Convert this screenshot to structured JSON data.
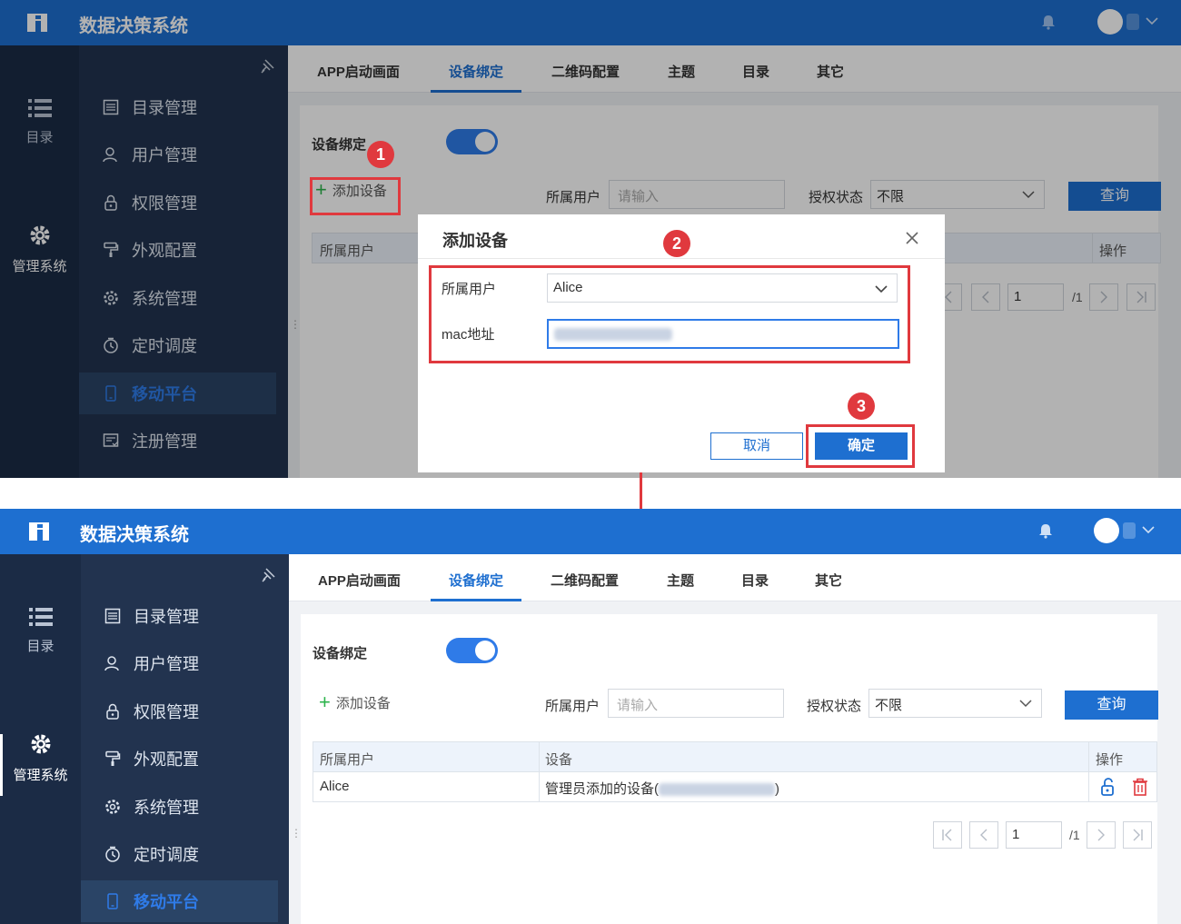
{
  "app": {
    "title": "数据决策系统"
  },
  "rail": {
    "catalog_label": "目录",
    "manage_label": "管理系统"
  },
  "menu": {
    "items": [
      {
        "label": "目录管理"
      },
      {
        "label": "用户管理"
      },
      {
        "label": "权限管理"
      },
      {
        "label": "外观配置"
      },
      {
        "label": "系统管理"
      },
      {
        "label": "定时调度"
      },
      {
        "label": "移动平台"
      },
      {
        "label": "注册管理"
      }
    ],
    "active_index": 6
  },
  "tabs": [
    {
      "label": "APP启动画面"
    },
    {
      "label": "设备绑定"
    },
    {
      "label": "二维码配置"
    },
    {
      "label": "主题"
    },
    {
      "label": "目录"
    },
    {
      "label": "其它"
    }
  ],
  "device_binding": {
    "toggle_label": "设备绑定",
    "toggle_on": true,
    "add_device_label": "添加设备",
    "owner_filter_label": "所属用户",
    "owner_filter_placeholder": "请输入",
    "auth_status_label": "授权状态",
    "auth_status_value": "不限",
    "query_label": "查询"
  },
  "table": {
    "columns": [
      "所属用户",
      "设备",
      "操作"
    ],
    "rows": [
      {
        "owner": "Alice",
        "device_prefix": "管理员添加的设备(",
        "device_suffix": ")"
      }
    ]
  },
  "pagination": {
    "page": "1",
    "total": "/1"
  },
  "dialog": {
    "title": "添加设备",
    "owner_label": "所属用户",
    "owner_value": "Alice",
    "mac_label": "mac地址",
    "cancel_label": "取消",
    "ok_label": "确定"
  },
  "steps": [
    "1",
    "2",
    "3"
  ],
  "colors": {
    "topbar": "#1e6fd0",
    "sidebar_rail": "#1b2b45",
    "sidebar_menu": "#22334f",
    "accent": "#2f7be8",
    "annotation_red": "#e0393e",
    "add_plus": "#2bb34b"
  }
}
